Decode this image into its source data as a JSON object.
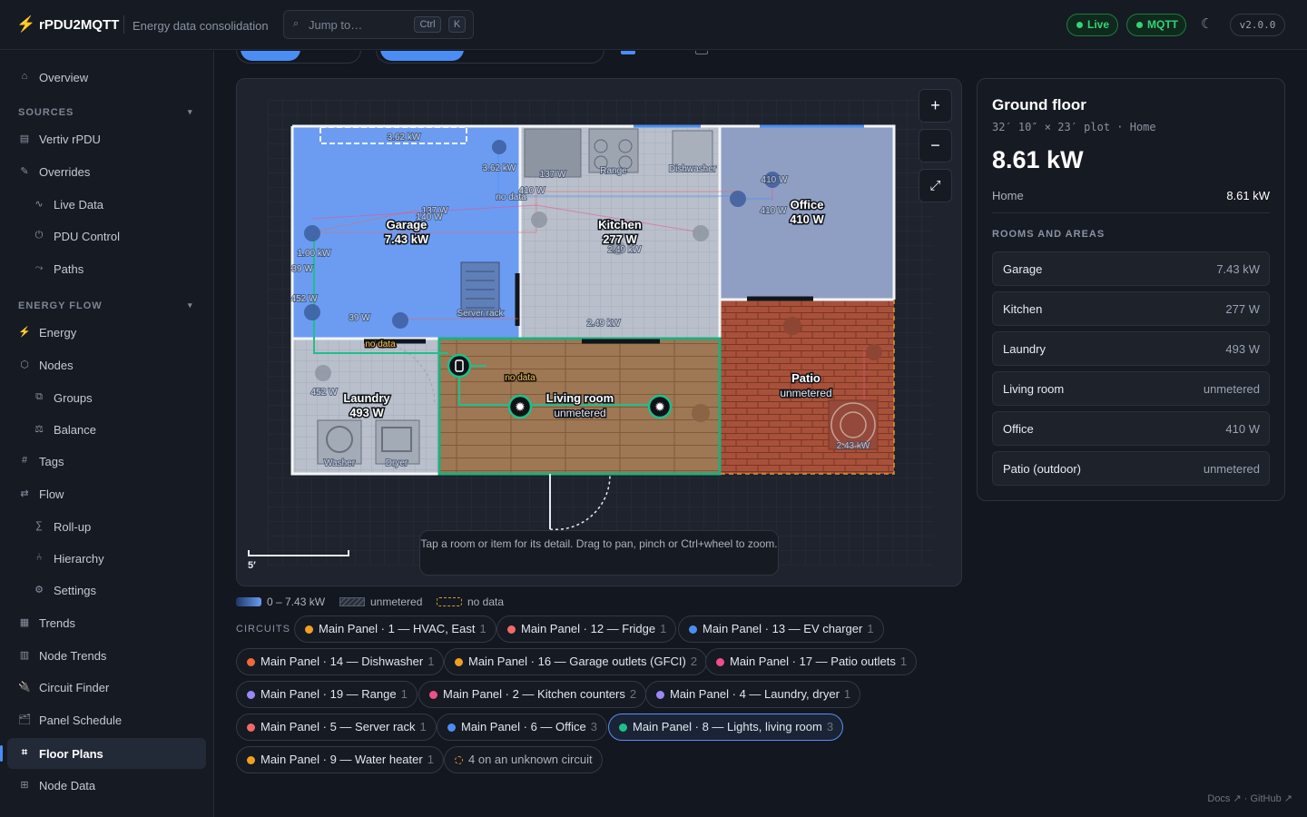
{
  "app": {
    "name": "rPDU2MQTT",
    "subtitle": "Energy data consolidation"
  },
  "search": {
    "placeholder": "Jump to…",
    "key1": "Ctrl",
    "key2": "K"
  },
  "status": {
    "live": "Live",
    "mqtt": "MQTT",
    "version": "v2.0.0"
  },
  "sidebar": {
    "overview": "Overview",
    "sources_section": "SOURCES",
    "vertiv": "Vertiv rPDU",
    "overrides": "Overrides",
    "live_data": "Live Data",
    "pdu_control": "PDU Control",
    "paths": "Paths",
    "energy_section": "ENERGY FLOW",
    "energy": "Energy",
    "nodes": "Nodes",
    "groups": "Groups",
    "balance": "Balance",
    "tags": "Tags",
    "flow": "Flow",
    "rollup": "Roll-up",
    "hierarchy": "Hierarchy",
    "settings": "Settings",
    "trends": "Trends",
    "node_trends": "Node Trends",
    "circuit_finder": "Circuit Finder",
    "panel_schedule": "Panel Schedule",
    "floor_plans": "Floor Plans",
    "node_data": "Node Data"
  },
  "map": {
    "hint": "Tap a room or item for its detail. Drag to pan, pinch or Ctrl+wheel to zoom.",
    "scale": "5′",
    "zoom_in": "+",
    "zoom_out": "−",
    "fit": "⤢",
    "rooms": {
      "garage": {
        "name": "Garage",
        "value": "7.43 kW"
      },
      "kitchen": {
        "name": "Kitchen",
        "value": "277 W"
      },
      "office": {
        "name": "Office",
        "value": "410 W"
      },
      "laundry": {
        "name": "Laundry",
        "value": "493 W"
      },
      "living": {
        "name": "Living room",
        "value": "unmetered"
      },
      "patio": {
        "name": "Patio",
        "value": "unmetered"
      }
    },
    "labels": {
      "garage_top": "3.62 kW",
      "garage_panel": "3.62 kW",
      "k1": "137 W",
      "k2": "no data",
      "k3": "410 W",
      "g1": "137 W",
      "g2": "140 W",
      "g3": "1.00 kW",
      "g4": "39 W",
      "g5": "452 W",
      "g6": "39 W",
      "range": "Range",
      "fridge_w": "137 W",
      "dishwasher": "Dishwasher",
      "k4": "2.49 kW",
      "server_rack": "Server rack",
      "o1": "410 W",
      "o2": "410 W",
      "nodata1": "no data",
      "nodata2": "no data",
      "k5": "2.49 kW",
      "laundry_w": "452 W",
      "washer": "Washer",
      "dryer": "Dryer",
      "patio_kw": "2.43 kW"
    }
  },
  "panel": {
    "title": "Ground floor",
    "subtitle": "32′ 10″ × 23′ plot · Home",
    "total": "8.61 kW",
    "home_label": "Home",
    "home_value": "8.61 kW",
    "rooms_heading": "ROOMS AND AREAS",
    "rooms": [
      {
        "name": "Garage",
        "value": "7.43 kW"
      },
      {
        "name": "Kitchen",
        "value": "277 W"
      },
      {
        "name": "Laundry",
        "value": "493 W"
      },
      {
        "name": "Living room",
        "value": "unmetered"
      },
      {
        "name": "Office",
        "value": "410 W"
      },
      {
        "name": "Patio (outdoor)",
        "value": "unmetered"
      }
    ]
  },
  "legend": {
    "range": "0 – 7.43 kW",
    "unmetered": "unmetered",
    "nodata": "no data"
  },
  "circuits_label": "CIRCUITS",
  "circuits": [
    {
      "label": "Main Panel · 1 — HVAC, East",
      "count": "1",
      "color": "#f0a020"
    },
    {
      "label": "Main Panel · 12 — Fridge",
      "count": "1",
      "color": "#f06a6a"
    },
    {
      "label": "Main Panel · 13 — EV charger",
      "count": "1",
      "color": "#4a8ef5"
    },
    {
      "label": "Main Panel · 14 — Dishwasher",
      "count": "1",
      "color": "#f2683c"
    },
    {
      "label": "Main Panel · 16 — Garage outlets (GFCI)",
      "count": "2",
      "color": "#f0a020"
    },
    {
      "label": "Main Panel · 17 — Patio outlets",
      "count": "1",
      "color": "#ec4f8a"
    },
    {
      "label": "Main Panel · 19 — Range",
      "count": "1",
      "color": "#9b87f5"
    },
    {
      "label": "Main Panel · 2 — Kitchen counters",
      "count": "2",
      "color": "#ec4f8a"
    },
    {
      "label": "Main Panel · 4 — Laundry, dryer",
      "count": "1",
      "color": "#9b87f5"
    },
    {
      "label": "Main Panel · 5 — Server rack",
      "count": "1",
      "color": "#f06a6a"
    },
    {
      "label": "Main Panel · 6 — Office",
      "count": "3",
      "color": "#4a8ef5"
    },
    {
      "label": "Main Panel · 8 — Lights, living room",
      "count": "3",
      "color": "#1fbf8a"
    },
    {
      "label": "Main Panel · 9 — Water heater",
      "count": "1",
      "color": "#f0a020"
    }
  ],
  "unknown_circuit": "4 on an unknown circuit",
  "footer": "Docs ↗ · GitHub ↗"
}
